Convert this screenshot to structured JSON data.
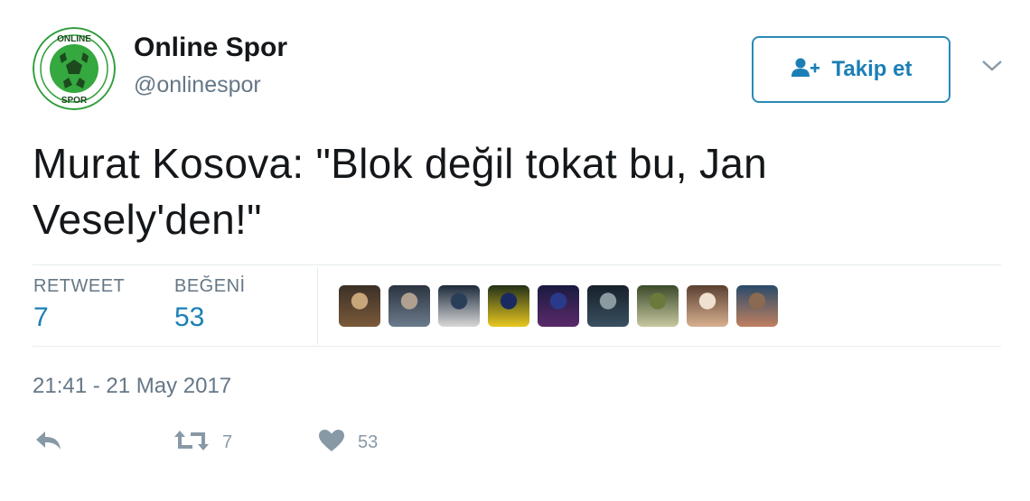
{
  "account": {
    "display_name": "Online Spor",
    "handle": "@onlinespor",
    "avatar_text_top": "ONLINE",
    "avatar_text_bottom": "SPOR"
  },
  "follow_button": {
    "label": "Takip et",
    "icon": "add-user-icon"
  },
  "menu": {
    "icon": "chevron-down-icon"
  },
  "tweet": {
    "text": "Murat Kosova: \"Blok değil tokat bu, Jan Vesely'den!\""
  },
  "stats": {
    "retweet_label": "RETWEET",
    "retweet_count": "7",
    "likes_label": "BEĞENİ",
    "likes_count": "53"
  },
  "likers": [
    {
      "name": "liker-1",
      "colors": [
        "#3b3026",
        "#7a5a3a",
        "#c9a57a"
      ]
    },
    {
      "name": "liker-2",
      "colors": [
        "#2c3440",
        "#6b7b8c",
        "#b0a090"
      ]
    },
    {
      "name": "liker-3",
      "colors": [
        "#1c2a3a",
        "#d8d8d8",
        "#2a3e5a"
      ]
    },
    {
      "name": "liker-4",
      "colors": [
        "#223018",
        "#e8c820",
        "#1a2a60"
      ]
    },
    {
      "name": "liker-5",
      "colors": [
        "#1a1a40",
        "#5a2a6a",
        "#2a3a8a"
      ]
    },
    {
      "name": "liker-6",
      "colors": [
        "#16202a",
        "#3a5060",
        "#8a9aa0"
      ]
    },
    {
      "name": "liker-7",
      "colors": [
        "#3a4a2a",
        "#c8c8a0",
        "#6a7a3a"
      ]
    },
    {
      "name": "liker-8",
      "colors": [
        "#5a4030",
        "#d8b090",
        "#f0e0d0"
      ]
    },
    {
      "name": "liker-9",
      "colors": [
        "#2a4a6a",
        "#c08060",
        "#8a6a50"
      ]
    }
  ],
  "timestamp": "21:41 - 21 May 2017",
  "actions": {
    "reply_icon": "reply-icon",
    "retweet_icon": "retweet-icon",
    "retweet_count": "7",
    "like_icon": "heart-icon",
    "like_count": "53"
  },
  "colors": {
    "accent": "#1b7fb6",
    "muted": "#657786",
    "action_gray": "#8899a6",
    "avatar_green": "#2e9e3a"
  }
}
